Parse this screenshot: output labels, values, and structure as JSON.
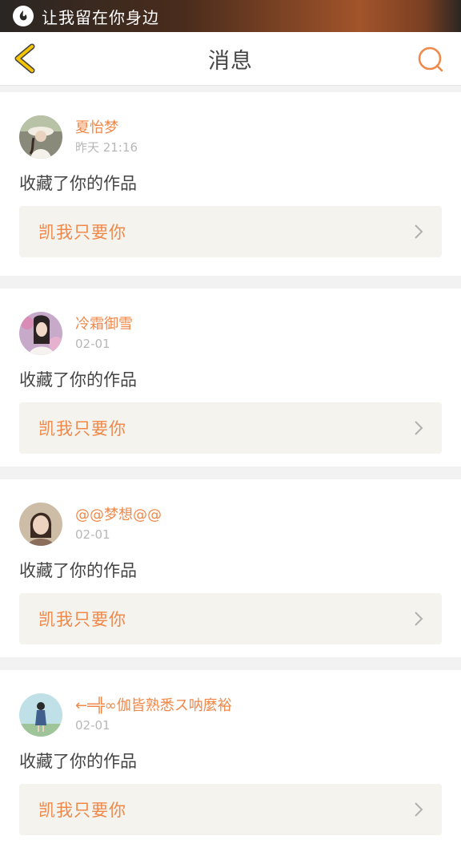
{
  "statusbar": {
    "title": "让我留在你身边",
    "icon": "music-note-icon"
  },
  "header": {
    "title": "消息",
    "back_icon": "back-arrow-icon",
    "search_icon": "search-icon"
  },
  "colors": {
    "accent": "#f0884a",
    "text": "#444444",
    "muted": "#b8b8b8",
    "card_inner": "#f4f3ee",
    "back_arrow": "#f5c400"
  },
  "messages": [
    {
      "user": "夏怡梦",
      "time": "昨天 21:16",
      "action": "收藏了你的作品",
      "work": "凯我只要你"
    },
    {
      "user": "冷霜御雪",
      "time": "02-01",
      "action": "收藏了你的作品",
      "work": "凯我只要你"
    },
    {
      "user": "@@梦想@@",
      "time": "02-01",
      "action": "收藏了你的作品",
      "work": "凯我只要你"
    },
    {
      "user": "←═╬∞伽皆熟悉ス呐麼裕",
      "time": "02-01",
      "action": "收藏了你的作品",
      "work": "凯我只要你"
    }
  ]
}
